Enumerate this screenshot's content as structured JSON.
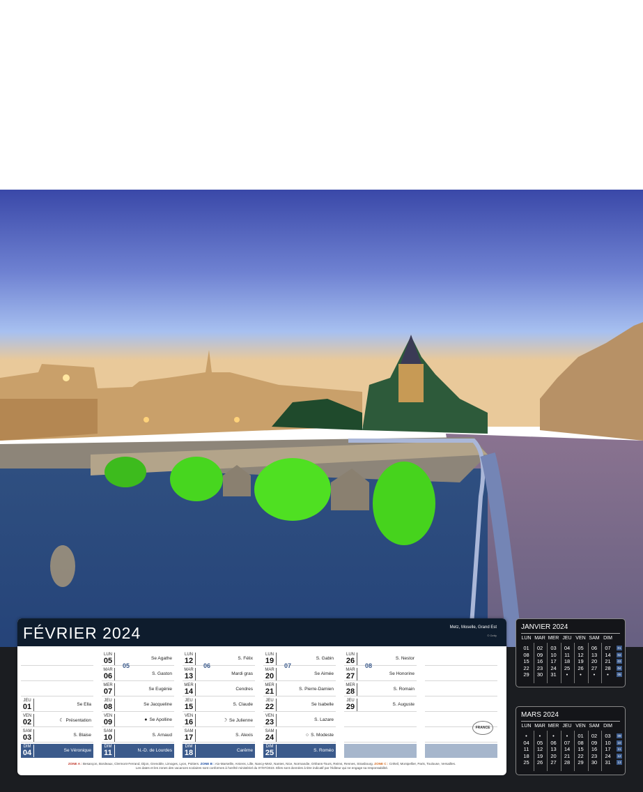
{
  "calendar": {
    "month_title": "FÉVRIER 2024",
    "location": "Metz, Moselle, Grand Est",
    "credit": "© Getty",
    "columns": [
      [
        {},
        {},
        {},
        {
          "dn": "JEU",
          "dd": "01",
          "saint": "Se Ella"
        },
        {
          "dn": "VEN",
          "dd": "02",
          "saint": "Présentation",
          "moon": "☾"
        },
        {
          "dn": "SAM",
          "dd": "03",
          "saint": "S. Blaise"
        },
        {
          "dn": "DIM",
          "dd": "04",
          "saint": "Se Véronique",
          "sunday": true
        }
      ],
      [
        {
          "dn": "LUN",
          "dd": "05",
          "saint": "Se Agathe"
        },
        {
          "dn": "MAR",
          "dd": "06",
          "saint": "S. Gaston"
        },
        {
          "dn": "MER",
          "dd": "07",
          "saint": "Se Eugénie"
        },
        {
          "dn": "JEU",
          "dd": "08",
          "saint": "Se Jacqueline"
        },
        {
          "dn": "VEN",
          "dd": "09",
          "saint": "Se Apolline",
          "moon": "●"
        },
        {
          "dn": "SAM",
          "dd": "10",
          "saint": "S. Arnaud"
        },
        {
          "dn": "DIM",
          "dd": "11",
          "saint": "N.-D. de Lourdes",
          "sunday": true
        }
      ],
      [
        {
          "dn": "LUN",
          "dd": "12",
          "saint": "S. Félix"
        },
        {
          "dn": "MAR",
          "dd": "13",
          "saint": "Mardi gras"
        },
        {
          "dn": "MER",
          "dd": "14",
          "saint": "Cendres"
        },
        {
          "dn": "JEU",
          "dd": "15",
          "saint": "S. Claude"
        },
        {
          "dn": "VEN",
          "dd": "16",
          "saint": "Se Julienne",
          "moon": "☽"
        },
        {
          "dn": "SAM",
          "dd": "17",
          "saint": "S. Alexis"
        },
        {
          "dn": "DIM",
          "dd": "18",
          "saint": "Carême",
          "sunday": true
        }
      ],
      [
        {
          "dn": "LUN",
          "dd": "19",
          "saint": "S. Gabin"
        },
        {
          "dn": "MAR",
          "dd": "20",
          "saint": "Se Aimée"
        },
        {
          "dn": "MER",
          "dd": "21",
          "saint": "S. Pierre-Damien"
        },
        {
          "dn": "JEU",
          "dd": "22",
          "saint": "Se Isabelle"
        },
        {
          "dn": "VEN",
          "dd": "23",
          "saint": "S. Lazare"
        },
        {
          "dn": "SAM",
          "dd": "24",
          "saint": "S. Modeste",
          "moon": "○"
        },
        {
          "dn": "DIM",
          "dd": "25",
          "saint": "S. Roméo",
          "sunday": true
        }
      ],
      [
        {
          "dn": "LUN",
          "dd": "26",
          "saint": "S. Nestor"
        },
        {
          "dn": "MAR",
          "dd": "27",
          "saint": "Se Honorine"
        },
        {
          "dn": "MER",
          "dd": "28",
          "saint": "S. Romain"
        },
        {
          "dn": "JEU",
          "dd": "29",
          "saint": "S. Auguste"
        },
        {},
        {},
        {
          "gray": true
        }
      ],
      [
        {},
        {},
        {},
        {},
        {},
        {},
        {
          "gray": true
        }
      ]
    ],
    "weeks": [
      "05",
      "06",
      "07",
      "08"
    ],
    "badge": "FRANCE",
    "zone_a_label": "ZONE A :",
    "zone_a": "Besançon, Bordeaux, Clermont-Ferrand, Dijon, Grenoble, Limoges, Lyon, Poitiers.",
    "zone_b_label": "ZONE B :",
    "zone_b": "Aix-Marseille, Amiens, Lille, Nancy-Metz, Nantes, Nice, Normandie, Orléans-Tours, Reims, Rennes, Strasbourg.",
    "zone_c_label": "ZONE C :",
    "zone_c": "Créteil, Montpellier, Paris, Toulouse, Versailles.",
    "footnote": "Les dates et les zones des vacances scolaires sont conformes à l'arrêté ministériel du 07/07/2023. Elles sont données à titre indicatif par l'éditeur qui ne engage sa responsabilité."
  },
  "mini_calendars": [
    {
      "title": "JANVIER 2024",
      "headers": [
        "LUN",
        "MAR",
        "MER",
        "JEU",
        "VEN",
        "SAM",
        "DIM"
      ],
      "rows": [
        [
          "01",
          "02",
          "03",
          "04",
          "05",
          "06",
          "07"
        ],
        [
          "08",
          "09",
          "10",
          "11",
          "12",
          "13",
          "14"
        ],
        [
          "15",
          "16",
          "17",
          "18",
          "19",
          "20",
          "21"
        ],
        [
          "22",
          "23",
          "24",
          "25",
          "26",
          "27",
          "28"
        ],
        [
          "29",
          "30",
          "31",
          "•",
          "•",
          "•",
          "•"
        ]
      ],
      "weeks": [
        "01",
        "02",
        "03",
        "04",
        "05"
      ]
    },
    {
      "title": "MARS 2024",
      "headers": [
        "LUN",
        "MAR",
        "MER",
        "JEU",
        "VEN",
        "SAM",
        "DIM"
      ],
      "rows": [
        [
          "•",
          "•",
          "•",
          "•",
          "01",
          "02",
          "03"
        ],
        [
          "04",
          "05",
          "06",
          "07",
          "08",
          "09",
          "10"
        ],
        [
          "11",
          "12",
          "13",
          "14",
          "15",
          "16",
          "17"
        ],
        [
          "18",
          "19",
          "20",
          "21",
          "22",
          "23",
          "24"
        ],
        [
          "25",
          "26",
          "27",
          "28",
          "29",
          "30",
          "31"
        ]
      ],
      "weeks": [
        "09",
        "10",
        "11",
        "12",
        "13"
      ]
    }
  ],
  "colors": {
    "accent": "#3b5a8b",
    "header": "#0e1c2d",
    "dark": "#1b1d21"
  }
}
